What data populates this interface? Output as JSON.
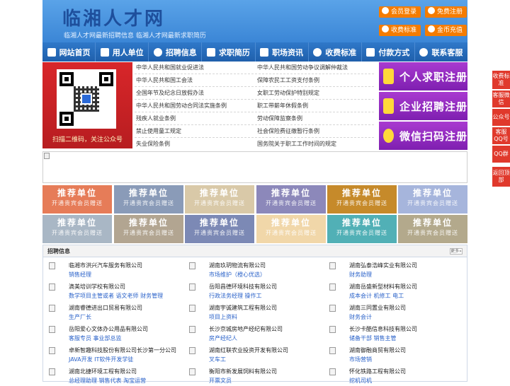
{
  "header": {
    "logo_title": "临湘人才网",
    "subtitle": "临湘人才网最新招聘信息   临湘人才网最新求职简历",
    "buttons": [
      {
        "label": "会员登录",
        "icon": "user-icon"
      },
      {
        "label": "免费注册",
        "icon": "register-icon"
      },
      {
        "label": "收费标准",
        "icon": "yen-icon"
      },
      {
        "label": "金币充值",
        "icon": "coin-icon"
      }
    ],
    "accent_color": "#f57c00"
  },
  "nav": {
    "items": [
      {
        "label": "网站首页",
        "icon": "home-icon"
      },
      {
        "label": "用人单位",
        "icon": "building-icon"
      },
      {
        "label": "招聘信息",
        "icon": "megaphone-icon"
      },
      {
        "label": "求职简历",
        "icon": "resume-icon"
      },
      {
        "label": "职场资讯",
        "icon": "news-icon"
      },
      {
        "label": "收费标准",
        "icon": "yen-icon"
      },
      {
        "label": "付款方式",
        "icon": "card-icon"
      },
      {
        "label": "联系客服",
        "icon": "phone-icon"
      }
    ]
  },
  "qr": {
    "caption": "扫描二维码，关注公众号"
  },
  "laws": {
    "left": [
      "中华人民共和国就业促进法",
      "中华人民共和国工会法",
      "全国年节及纪念日放假办法",
      "中华人民共和国劳动合同法实施条例",
      "残疾人就业条例",
      "禁止使用童工规定",
      "失业保险条例"
    ],
    "right": [
      "中华人民共和国劳动争议调解仲裁法",
      "保障农民工工资支付条例",
      "女职工劳动保护特别规定",
      "职工带薪年休假条例",
      "劳动保障监察条例",
      "社会保险费征缴暂行条例",
      "国务院关于职工工作时间的规定"
    ]
  },
  "register": [
    {
      "label": "个人求职注册",
      "icon": "person-icon"
    },
    {
      "label": "企业招聘注册",
      "icon": "company-icon"
    },
    {
      "label": "微信扫码注册",
      "icon": "wechat-icon"
    }
  ],
  "side_bar": [
    {
      "label": "收费标准"
    },
    {
      "label": "客服微信"
    },
    {
      "label": "公众号"
    },
    {
      "label": "客服QQ号"
    },
    {
      "label": "QQ群"
    },
    {
      "label": "返回顶部"
    }
  ],
  "recommend": {
    "title": "推荐单位",
    "subtitle": "开通贵宾会员赠送",
    "colors": [
      "#e67c58",
      "#8a9bb8",
      "#d9c9a8",
      "#8c88ba",
      "#c68a2a",
      "#a6b5dc",
      "#a9b7c5",
      "#b2a591",
      "#7c89b5",
      "#f1d7a9",
      "#51b0b6",
      "#b3a98c"
    ]
  },
  "jobs": {
    "title": "招聘信息",
    "more": "更多»",
    "columns": [
      [
        {
          "company": "临湘市洪兴汽车服务有限公司",
          "positions": "销售经理"
        },
        {
          "company": "滴美培训学校有限公司",
          "positions": "数学项目主管或者  语文老师  财务管理"
        },
        {
          "company": "湖南睿德进出口贸易有限公司",
          "positions": "生产厂长"
        },
        {
          "company": "岳阳爱心文体办公用品有限公司",
          "positions": "客服专员  事业部总监"
        },
        {
          "company": "卓新智趣科技股份有限公司长沙第一分公司",
          "positions": "JAVA开发  IT软件开发学徒"
        },
        {
          "company": "湖南北捷环境工程有限公司",
          "positions": "总经理助理  销售代表  淘宝运营"
        }
      ],
      [
        {
          "company": "湖南玖玥物流有限公司",
          "positions": "市场维护（橙心优选）"
        },
        {
          "company": "岳阳昌德环境科技有限公司",
          "positions": "行政法务经理  操作工"
        },
        {
          "company": "湖南宇诚建筑工程有限公司",
          "positions": "项目上资料"
        },
        {
          "company": "长沙京城房地产经纪有限公司",
          "positions": "房产经纪人"
        },
        {
          "company": "湖南红联农业投资开发有限公司",
          "positions": "叉车工"
        },
        {
          "company": "衡阳市新发展饲料有限公司",
          "positions": "开票文员"
        }
      ],
      [
        {
          "company": "湖南弘泰浩峰实业有限公司",
          "positions": "财务助理"
        },
        {
          "company": "湖南岳盛新型材料有限公司",
          "positions": "成本会计  机修工  电工"
        },
        {
          "company": "湖南三同置业有限公司",
          "positions": "财务会计"
        },
        {
          "company": "长沙卡酷信息科技有限公司",
          "positions": "储备干部  销售主管"
        },
        {
          "company": "湖南御融商贸有限公司",
          "positions": "市场营销"
        },
        {
          "company": "怀化铁路工程有限公司",
          "positions": "挖机司机"
        }
      ]
    ]
  }
}
